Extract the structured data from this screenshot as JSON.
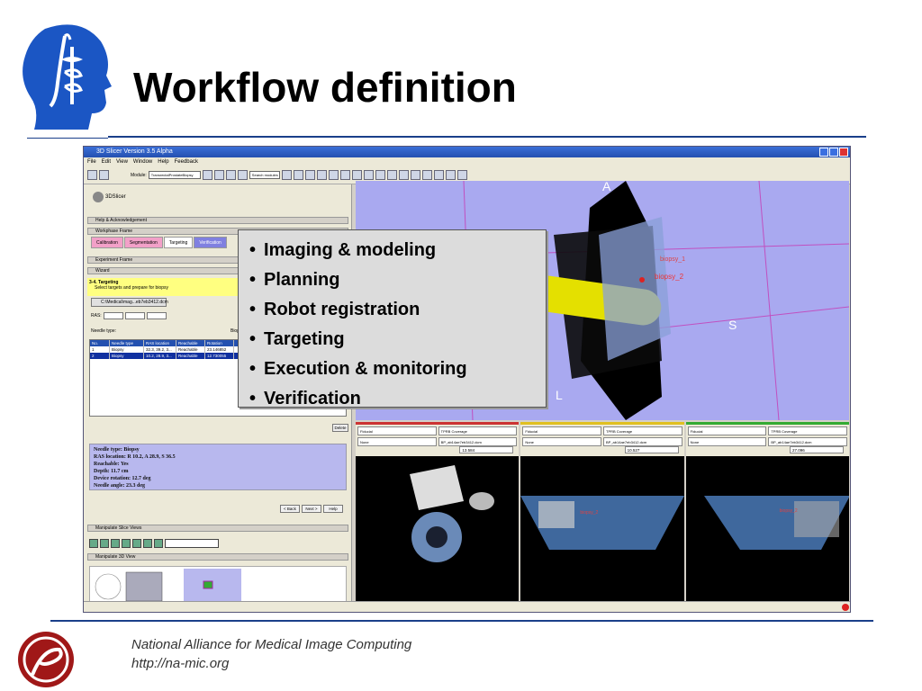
{
  "slide": {
    "title": "Workflow definition",
    "bullets": [
      "Imaging & modeling",
      "Planning",
      "Robot registration",
      "Targeting",
      "Execution & monitoring",
      "Verification"
    ],
    "footer": {
      "org": "National Alliance for Medical Image Computing",
      "url": "http://na-mic.org"
    },
    "accent_color": "#1a3f8a"
  },
  "app": {
    "window_title": "3D Slicer Version 3.5 Alpha",
    "menu": [
      "File",
      "Edit",
      "View",
      "Window",
      "Help",
      "Feedback"
    ],
    "toolbar": {
      "module_label": "Module:",
      "module_value": "TransrectalProstateBiopsy",
      "search_placeholder": "Search modules"
    },
    "logo_text": "3DSlicer",
    "sections": {
      "help": "Help & Acknowledgement",
      "workphase": "Workphase Frame",
      "experiment": "Experiment Frame",
      "wizard": "Wizard",
      "slice_views": "Manipulate Slice Views",
      "view3d": "Manipulate 3D View"
    },
    "workphase_tabs": [
      "Calibration",
      "Segmentation",
      "Targeting",
      "Verification"
    ],
    "wizard": {
      "step": "3-4. Targeting",
      "instruction": "Select targets and prepare for biopsy",
      "file_button": "C:\\Medical\\mag...eb7eb3412.dcm",
      "ras_label": "RAS:",
      "needle_type_label": "Needle type:",
      "needle_type_value": "Biopsy"
    },
    "target_table": {
      "headers": [
        "No.",
        "Needle type",
        "RAS location",
        "Reachable",
        "Rotation"
      ],
      "rows": [
        [
          "1",
          "Biopsy",
          "32.3, 39.2, 3...",
          "Reachable",
          "23.146852"
        ],
        [
          "2",
          "Biopsy",
          "10.2, 28.9, 3...",
          "Reachable",
          "12.730055"
        ]
      ]
    },
    "delete_label": "Delete",
    "info": [
      "Needle type: Biopsy",
      "RAS location: R 10.2, A 28.9, S 36.5",
      "Reachable: Yes",
      "Depth: 11.7 cm",
      "Device rotation: 12.7 deg",
      "Needle angle: 23.3 deg"
    ],
    "nav": {
      "back": "< Back",
      "next": "Next >",
      "help": "Help"
    },
    "view3d_labels": {
      "a": "A",
      "s": "S",
      "l": "L",
      "target1": "biopsy_1",
      "target2": "biopsy_2"
    },
    "slices": [
      {
        "fg": "Fiducial",
        "bg": "TPRB Coverage",
        "lbl": "None",
        "vol": "BP_ab14ae7eb3412.dcm",
        "value": "13.584"
      },
      {
        "fg": "Fiducial",
        "bg": "TPRB Coverage",
        "lbl": "None",
        "vol": "BP_ab14ae7eb3412.dcm",
        "value": "10.527"
      },
      {
        "fg": "Fiducial",
        "bg": "TPRB Coverage",
        "lbl": "None",
        "vol": "BP_ab14ae7eb3412.dcm",
        "value": "27.096"
      }
    ],
    "slice_target_labels": [
      "biopsy_2",
      "biopsy_2"
    ],
    "slice_colors": [
      "#cc3333",
      "#e0c020",
      "#33aa33"
    ]
  }
}
